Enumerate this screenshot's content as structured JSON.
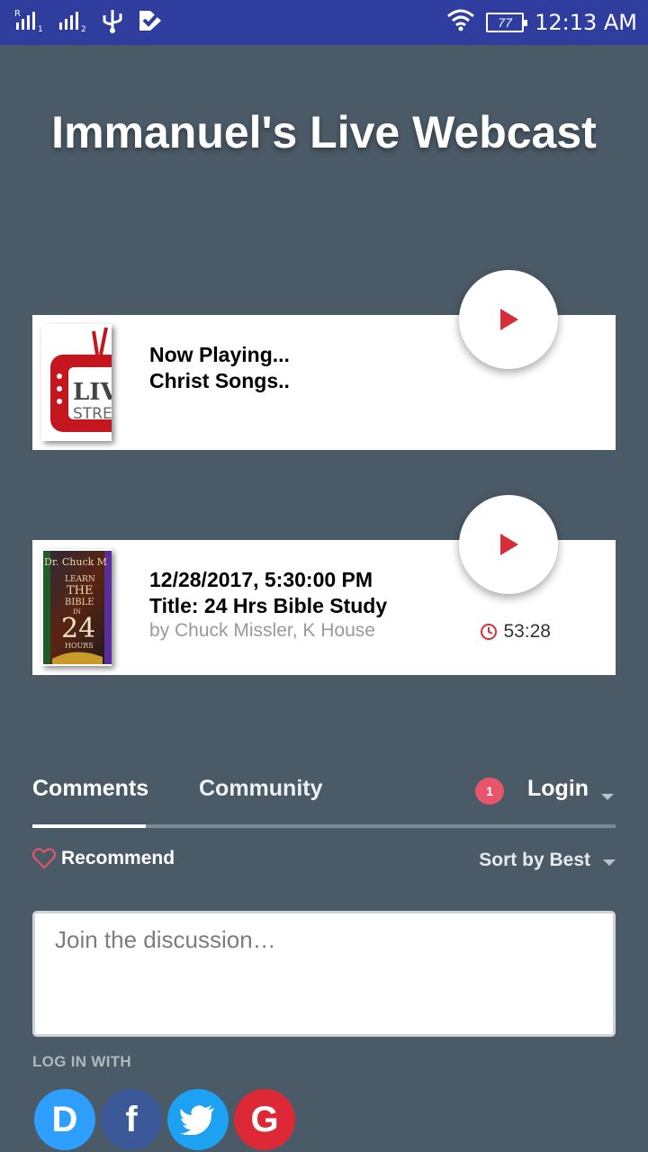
{
  "status_bar": {
    "time": "12:13 AM",
    "battery": "77",
    "icons": [
      "signal-1-icon",
      "signal-2-icon",
      "usb-icon",
      "app-check-icon",
      "wifi-icon",
      "battery-icon"
    ]
  },
  "title": "Immanuel's Live Webcast",
  "now_playing": {
    "line1": "Now Playing...",
    "line2": "Christ Songs..",
    "thumb_text_top": "LIV",
    "thumb_text_bottom": "STREA"
  },
  "episode": {
    "datetime": "12/28/2017, 5:30:00 PM",
    "title": "Title: 24 Hrs Bible Study",
    "author": "by Chuck Missler, K House",
    "duration": "53:28",
    "thumb_text": [
      "Dr. Chuck M",
      "LEARN",
      "THE",
      "BIBLE",
      "IN",
      "24",
      "HOURS"
    ]
  },
  "comments": {
    "tabs": [
      "Comments",
      "Community"
    ],
    "notification_count": "1",
    "login_label": "Login",
    "recommend_label": "Recommend",
    "sort_label": "Sort by Best",
    "input_placeholder": "Join the discussion…",
    "login_with_label": "LOG IN WITH",
    "social": [
      {
        "name": "disqus",
        "glyph": "D",
        "color": "#2e9fff"
      },
      {
        "name": "facebook",
        "glyph": "f",
        "color": "#3b5998"
      },
      {
        "name": "twitter",
        "glyph": "",
        "color": "#1da1f2"
      },
      {
        "name": "google",
        "glyph": "G",
        "color": "#dd2935"
      }
    ]
  },
  "colors": {
    "background": "#4a5a66",
    "status_bar": "#2f3d9e",
    "accent_red": "#d62f3a",
    "badge": "#e8556b"
  }
}
